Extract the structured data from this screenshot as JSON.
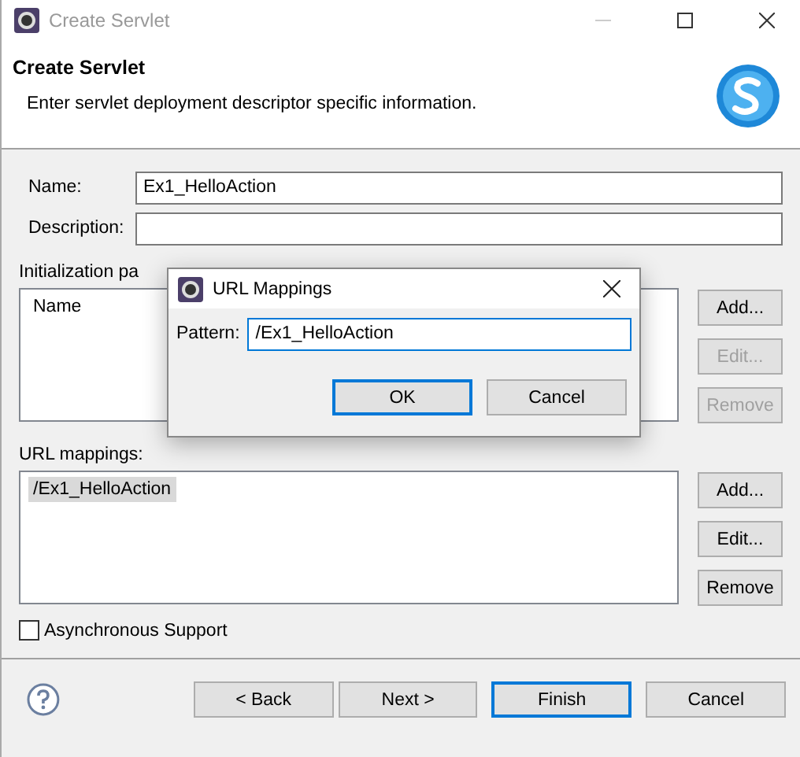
{
  "window": {
    "title": "Create Servlet"
  },
  "header": {
    "title": "Create Servlet",
    "description": "Enter servlet deployment descriptor specific information."
  },
  "fields": [
    {
      "label": "Name:",
      "value": "Ex1_HelloAction"
    },
    {
      "label": "Description:"
    }
  ],
  "init_params": {
    "label": "Initialization pa",
    "columns": [
      "Name"
    ],
    "buttons": [
      {
        "label": "Add...",
        "disabled": false
      },
      {
        "label": "Edit...",
        "disabled": true
      },
      {
        "label": "Remove",
        "disabled": true
      }
    ]
  },
  "url_mappings": {
    "label": "URL mappings:",
    "items": [
      {
        "text": "/Ex1_HelloAction",
        "selected": true
      }
    ],
    "buttons": [
      {
        "label": "Add...",
        "disabled": false
      },
      {
        "label": "Edit...",
        "disabled": false
      },
      {
        "label": "Remove",
        "disabled": false
      }
    ]
  },
  "async_support": {
    "label": "Asynchronous Support",
    "checked": false
  },
  "footer_buttons": [
    {
      "label": "< Back",
      "default": false
    },
    {
      "label": "Next >",
      "default": false
    },
    {
      "label": "Finish",
      "default": true
    },
    {
      "label": "Cancel",
      "default": false
    }
  ],
  "dialog": {
    "title": "URL Mappings",
    "pattern_label": "Pattern:",
    "pattern_value": "/Ex1_HelloAction",
    "buttons": [
      {
        "label": "OK",
        "default": true
      },
      {
        "label": "Cancel",
        "default": false
      }
    ]
  }
}
